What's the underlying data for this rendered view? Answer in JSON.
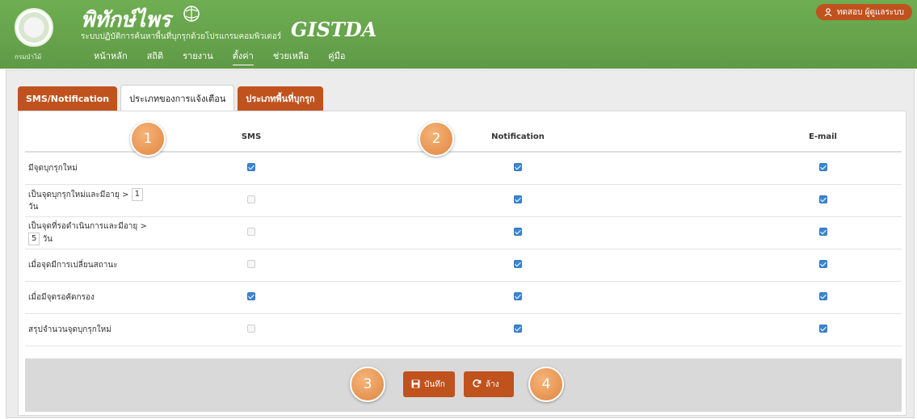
{
  "header": {
    "seal_label": "กรมป่าไม้",
    "brand_title": "พิทักษ์ไพร",
    "brand_subtitle": "ระบบปฏิบัติการค้นหาพื้นที่บุกรุกด้วยโปรแกรมคอมพิวเตอร์",
    "partner_logo": "GISTDA",
    "nav": [
      "หน้าหลัก",
      "สถิติ",
      "รายงาน",
      "ตั้งค่า",
      "ช่วยเหลือ",
      "คู่มือ"
    ],
    "active_nav": "ตั้งค่า",
    "user": "ทดสอบ ผู้ดูแลระบบ"
  },
  "tabs": [
    {
      "label": "SMS/Notification",
      "active": false
    },
    {
      "label": "ประเภทของการแจ้งเตือน",
      "active": true
    },
    {
      "label": "ประเภทพื้นที่บุกรุก",
      "active": false
    }
  ],
  "table": {
    "columns": [
      "",
      "SMS",
      "Notification",
      "E-mail"
    ],
    "rows": [
      {
        "label": "มีจุดบุกรุกใหม่",
        "sms": true,
        "notification": true,
        "email": true
      },
      {
        "label_before": "เป็นจุดบุกรุกใหม่และมีอายุ >",
        "value": "1",
        "label_after": "วัน",
        "sms": false,
        "notification": true,
        "email": true
      },
      {
        "label_before": "เป็นจุดที่รอดำเนินการและมีอายุ >",
        "value": "5",
        "label_after": "วัน",
        "sms": false,
        "notification": true,
        "email": true
      },
      {
        "label": "เมื่อจุดมีการเปลี่ยนสถานะ",
        "sms": false,
        "notification": true,
        "email": true
      },
      {
        "label": "เมื่อมีจุดรอคัดกรอง",
        "sms": true,
        "notification": true,
        "email": true
      },
      {
        "label": "สรุปจำนวนจุดบุกรุกใหม่",
        "sms": false,
        "notification": true,
        "email": true
      }
    ]
  },
  "buttons": {
    "save_label": "บันทึก",
    "clear_label": "ล้าง"
  },
  "markers": [
    "1",
    "2",
    "3",
    "4"
  ],
  "colors": {
    "header_green": "#6aa84f",
    "accent_orange": "#c0521e",
    "checkbox_blue": "#3b86d6",
    "marker_orange": "#e0863f"
  },
  "icons": {
    "user": "user-icon",
    "save": "floppy-icon",
    "clear": "refresh-icon"
  }
}
